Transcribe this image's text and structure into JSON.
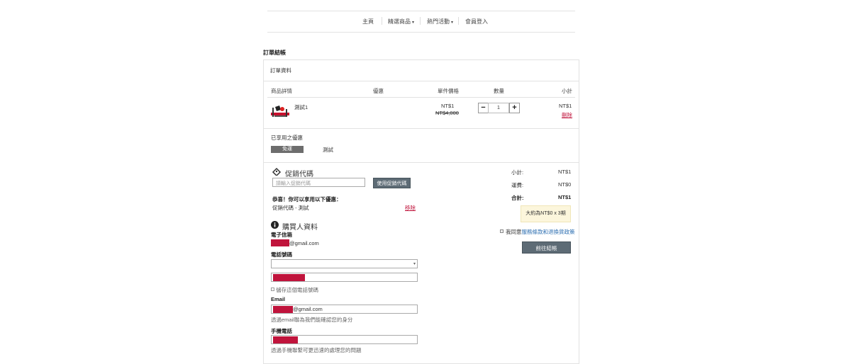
{
  "nav": {
    "items": [
      {
        "label": "主頁"
      },
      {
        "label": "精選商品",
        "caret": "▾"
      },
      {
        "label": "熱門活動",
        "caret": "▾"
      },
      {
        "label": "會員登入"
      }
    ]
  },
  "page_title": "訂單結帳",
  "order_section_title": "訂單資料",
  "table": {
    "headers": [
      "商品詳情",
      "優惠",
      "單件價格",
      "數量",
      "小計"
    ],
    "row": {
      "product_name": "測試1",
      "price": "NT$1",
      "original_price": "NT$4,000",
      "quantity": "1",
      "subtotal": "NT$1",
      "delete_label": "刪除"
    }
  },
  "applied_offers": {
    "title": "已享用之優惠",
    "badge": "免運",
    "name": "測試"
  },
  "promo": {
    "title": "促銷代碼",
    "placeholder": "請輸入促銷代碼",
    "button": "使用促銷代碼",
    "congrats": "恭喜！你可以享用以下優惠：",
    "item": "促銷代碼 - 測試",
    "remove": "移除"
  },
  "summary": {
    "subtotal_label": "小計:",
    "subtotal_value": "NT$1",
    "shipping_label": "運費:",
    "shipping_value": "NT$0",
    "total_label": "合計:",
    "total_value": "NT$1",
    "installment": "大約為NT$0 x 3期",
    "agree_prefix": "我同意",
    "agree_link": "服務條款和退換貨政策",
    "checkout_button": "前往結帳"
  },
  "buyer": {
    "title": "購買人資料",
    "email_label": "電子信箱",
    "email_suffix": "@gmail.com",
    "phone_label": "電話號碼",
    "save_phone": "儲存這個電話號碼",
    "email2_label": "Email",
    "email2_suffix": "@gmail.com",
    "email2_hint": "透過email聯為我們能確認您的身分",
    "mobile_label": "手機電話",
    "mobile_hint": "透過手機聯繫可更迅速的處理您的問題"
  },
  "colors": {
    "redaction": "#c0143c",
    "badge_bg": "#6d6d6d",
    "button_bg": "#5d6b75",
    "installment_bg": "#fcf6dc"
  }
}
